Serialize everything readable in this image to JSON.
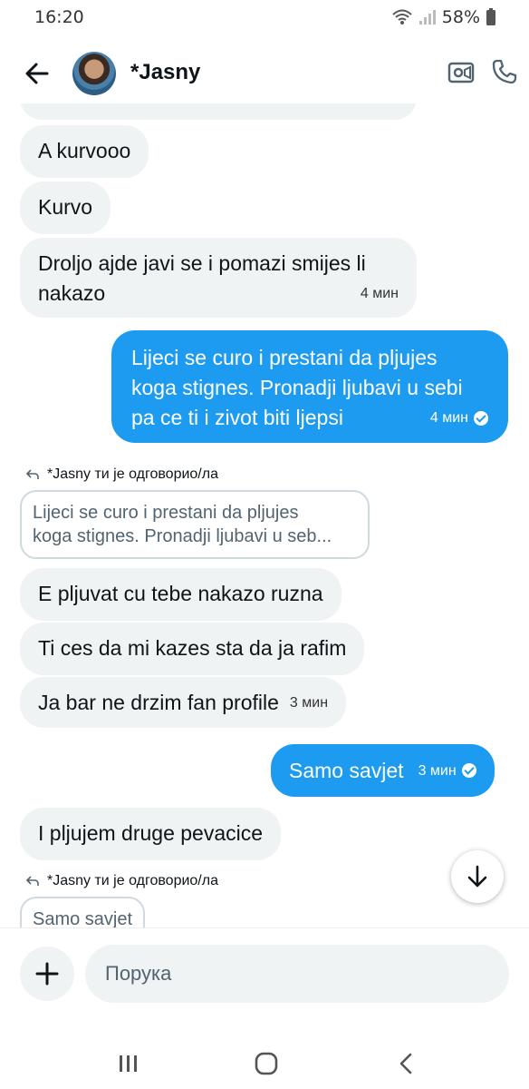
{
  "status_bar": {
    "time": "16:20",
    "battery": "58%"
  },
  "header": {
    "contact_name": "*Jasny"
  },
  "messages": [
    {
      "side": "in",
      "text": "A kurvooo"
    },
    {
      "side": "in",
      "text": "Kurvo"
    },
    {
      "side": "in",
      "text_line1": "Droljo ajde javi se i pomazi smijes li",
      "text_line2": "nakazo",
      "time": "4 мин"
    },
    {
      "side": "out",
      "text_line1": "Lijeci se curo i prestani da pljujes",
      "text_line2": "koga stignes. Pronadji ljubavi u sebi",
      "text_line3": "pa ce ti i zivot biti ljepsi",
      "time": "4 мин"
    },
    {
      "side": "reply_label",
      "text": "*Jasny ти је одговорио/ла"
    },
    {
      "side": "quote",
      "text_line1": "Lijeci se curo i prestani da pljujes",
      "text_line2": "koga stignes. Pronadji ljubavi u seb..."
    },
    {
      "side": "in",
      "text": "E pljuvat cu tebe nakazo ruzna"
    },
    {
      "side": "in",
      "text": "Ti ces da mi kazes sta da ja rafim"
    },
    {
      "side": "in",
      "text": "Ja bar ne drzim fan profile",
      "time": "3 мин"
    },
    {
      "side": "out",
      "text": "Samo savjet",
      "time": "3 мин"
    },
    {
      "side": "in",
      "text": "I pljujem druge pevacice"
    },
    {
      "side": "reply_label",
      "text": "*Jasny ти је одговорио/ла"
    },
    {
      "side": "quote",
      "text": "Samo savjet"
    }
  ],
  "composer": {
    "placeholder": "Порука"
  },
  "icons": {
    "back": "arrow-left-icon",
    "video": "video-camera-icon",
    "call": "phone-icon",
    "reply": "reply-arrow-icon",
    "scroll_down": "arrow-down-icon",
    "add": "plus-icon",
    "recents": "recents-icon",
    "home": "home-icon",
    "nav_back": "chevron-left-icon"
  },
  "colors": {
    "outgoing": "#1d9bf0",
    "incoming": "#eff3f4"
  }
}
